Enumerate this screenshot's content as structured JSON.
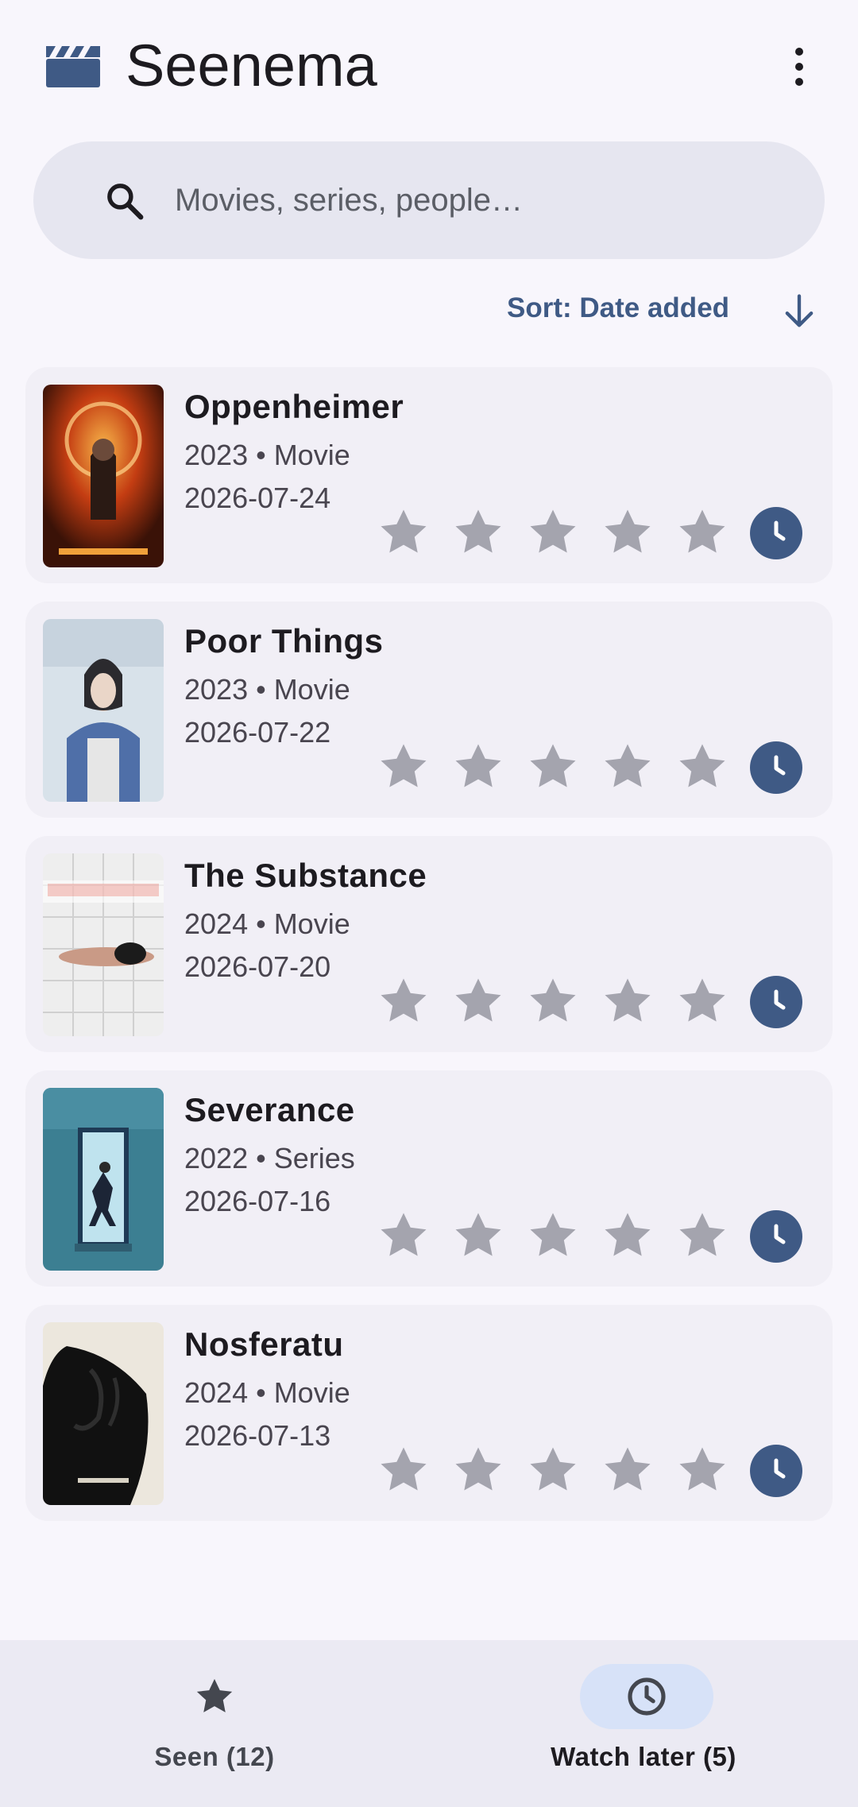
{
  "app": {
    "title": "Seenema",
    "logo_icon": "clapperboard-icon",
    "menu_icon": "more-vert-icon"
  },
  "search": {
    "placeholder": "Movies, series, people…",
    "value": "",
    "icon": "search-icon"
  },
  "sort": {
    "label": "Sort: Date added",
    "direction_icon": "arrow-down-icon"
  },
  "colors": {
    "accent": "#3f5a85",
    "star_empty": "#a4a4ae",
    "card_bg": "#f1eff6"
  },
  "items": [
    {
      "title": "Oppenheimer",
      "meta": "2023 • Movie",
      "date": "2026-07-24",
      "rating": 0,
      "watch_later": true,
      "poster_icon": "oppenheimer-poster"
    },
    {
      "title": "Poor Things",
      "meta": "2023 • Movie",
      "date": "2026-07-22",
      "rating": 0,
      "watch_later": true,
      "poster_icon": "poor-things-poster"
    },
    {
      "title": "The Substance",
      "meta": "2024 • Movie",
      "date": "2026-07-20",
      "rating": 0,
      "watch_later": true,
      "poster_icon": "the-substance-poster"
    },
    {
      "title": "Severance",
      "meta": "2022 • Series",
      "date": "2026-07-16",
      "rating": 0,
      "watch_later": true,
      "poster_icon": "severance-poster"
    },
    {
      "title": "Nosferatu",
      "meta": "2024 • Movie",
      "date": "2026-07-13",
      "rating": 0,
      "watch_later": true,
      "poster_icon": "nosferatu-poster"
    }
  ],
  "bottom_nav": [
    {
      "label": "Seen (12)",
      "icon": "star-icon",
      "active": false
    },
    {
      "label": "Watch later (5)",
      "icon": "clock-icon",
      "active": true
    }
  ]
}
